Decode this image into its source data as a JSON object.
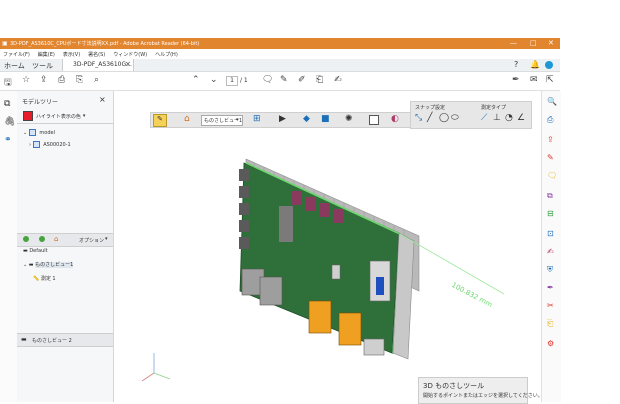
{
  "window": {
    "title": "3D-PDF_AS3610C_CPUボード寸法説明XX.pdf - Adobe Acrobat Reader (64-bit)",
    "minimize": "—",
    "maximize": "□",
    "close": "✕"
  },
  "menu": {
    "items": [
      "ファイル(F)",
      "編集(E)",
      "表示(V)",
      "署名(S)",
      "ウィンドウ(W)",
      "ヘルプ(H)"
    ]
  },
  "tabs": {
    "home": "ホーム",
    "tools": "ツール",
    "doc": "3D-PDF_AS3610G..."
  },
  "toolbar": {
    "page_current": "1",
    "page_total": "/ 1"
  },
  "model_tree": {
    "title": "モデルツリー",
    "highlight_label": "ハイライト表示の色",
    "root": "model",
    "child": "AS00020-1",
    "options_label": "オプション",
    "views": [
      {
        "label": "Default"
      },
      {
        "label": "ものさしビュー1"
      }
    ],
    "measure_item": "測定 1",
    "bottom_view": "ものさしビュー 2"
  },
  "viewport": {
    "view_select": "ものさしビュー1",
    "snap_label": "スナップ設定",
    "measure_type_label": "測定タイプ",
    "dimension": "100.832 mm",
    "tooltip_title": "3D ものさしツール",
    "tooltip_text": "開始するポイントまたはエッジを選択してください。"
  },
  "colors": {
    "accent": "#e2852f",
    "pcb": "#2f6f3a",
    "measure": "#6fd66f",
    "heatsink": "#b9b9b9"
  }
}
